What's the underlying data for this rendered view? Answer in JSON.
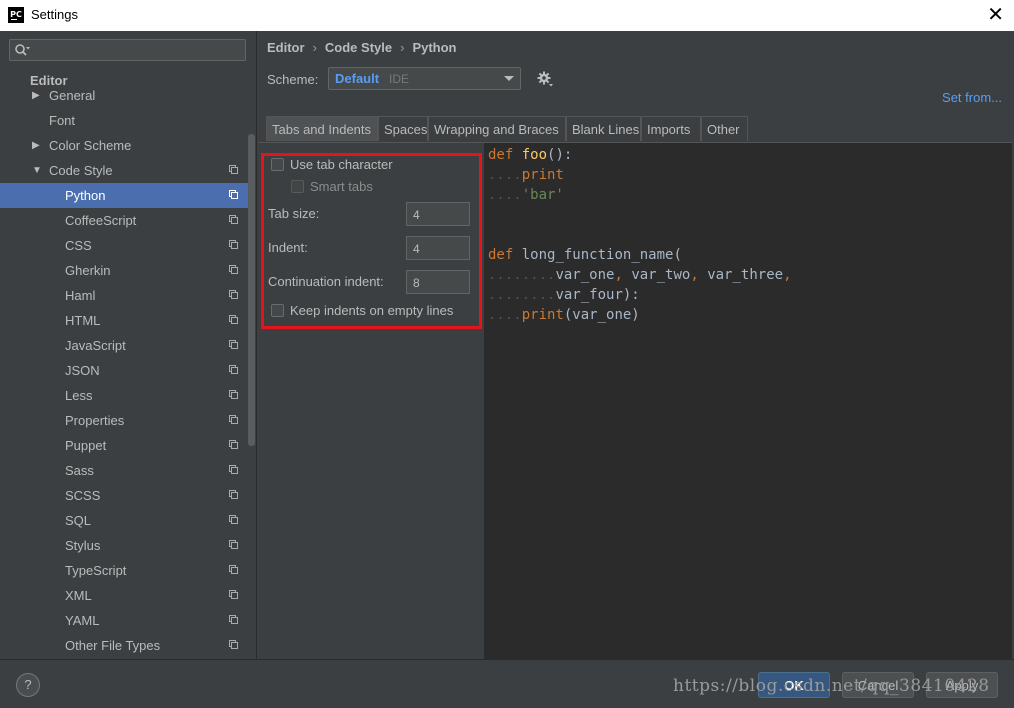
{
  "window": {
    "title": "Settings",
    "app_icon": "PC",
    "close_glyph": "✕"
  },
  "sidebar": {
    "search": {
      "value": "",
      "placeholder": ""
    },
    "section": "Editor",
    "items": [
      {
        "label": "General",
        "arrow": "▶",
        "level": 0
      },
      {
        "label": "Font",
        "arrow": "",
        "level": 0
      },
      {
        "label": "Color Scheme",
        "arrow": "▶",
        "level": 0
      },
      {
        "label": "Code Style",
        "arrow": "▼",
        "level": 0,
        "copy": true
      },
      {
        "label": "Python",
        "level": 1,
        "copy": true,
        "selected": true
      },
      {
        "label": "CoffeeScript",
        "level": 1,
        "copy": true
      },
      {
        "label": "CSS",
        "level": 1,
        "copy": true
      },
      {
        "label": "Gherkin",
        "level": 1,
        "copy": true
      },
      {
        "label": "Haml",
        "level": 1,
        "copy": true
      },
      {
        "label": "HTML",
        "level": 1,
        "copy": true
      },
      {
        "label": "JavaScript",
        "level": 1,
        "copy": true
      },
      {
        "label": "JSON",
        "level": 1,
        "copy": true
      },
      {
        "label": "Less",
        "level": 1,
        "copy": true
      },
      {
        "label": "Properties",
        "level": 1,
        "copy": true
      },
      {
        "label": "Puppet",
        "level": 1,
        "copy": true
      },
      {
        "label": "Sass",
        "level": 1,
        "copy": true
      },
      {
        "label": "SCSS",
        "level": 1,
        "copy": true
      },
      {
        "label": "SQL",
        "level": 1,
        "copy": true
      },
      {
        "label": "Stylus",
        "level": 1,
        "copy": true
      },
      {
        "label": "TypeScript",
        "level": 1,
        "copy": true
      },
      {
        "label": "XML",
        "level": 1,
        "copy": true
      },
      {
        "label": "YAML",
        "level": 1,
        "copy": true
      },
      {
        "label": "Other File Types",
        "level": 1,
        "copy": true
      }
    ]
  },
  "breadcrumb": {
    "items": [
      "Editor",
      "Code Style",
      "Python"
    ],
    "sep": "›"
  },
  "scheme": {
    "label": "Scheme:",
    "name": "Default",
    "sub": "IDE"
  },
  "set_from": "Set from...",
  "tabs": [
    "Tabs and Indents",
    "Spaces",
    "Wrapping and Braces",
    "Blank Lines",
    "Imports",
    "Other"
  ],
  "options": {
    "use_tab_character": "Use tab character",
    "smart_tabs": "Smart tabs",
    "tab_size_label": "Tab size:",
    "tab_size": "4",
    "indent_label": "Indent:",
    "indent": "4",
    "continuation_label": "Continuation indent:",
    "continuation": "8",
    "keep_indents": "Keep indents on empty lines"
  },
  "code": {
    "l1_kw": "def",
    "l1_fn": "foo",
    "l1_rest": "():",
    "l2_dots": "....",
    "l2_text": "print",
    "l3_dots": "....",
    "l3_str": "'bar'",
    "l6_kw": "def",
    "l6_fn": "long_function_name",
    "l6_rest": "(",
    "l7_dots": "........",
    "l7_a": "var_one",
    "l7_c1": ",",
    "l7_b": " var_two",
    "l7_c2": ",",
    "l7_c": " var_three",
    "l7_c3": ",",
    "l8_dots": "........",
    "l8_a": "var_four",
    "l8_rest": "):",
    "l9_dots": "....",
    "l9_fn": "print",
    "l9_rest": "(var_one)"
  },
  "footer": {
    "help": "?",
    "ok": "OK",
    "cancel": "Cancel",
    "apply": "Apply"
  },
  "watermark": "https://blog.csdn.net/qq_38410428",
  "colors": {
    "accent": "#4b6eaf",
    "link": "#589df6",
    "highlight": "#e5141b",
    "keyword": "#cc7832",
    "function": "#ffc66d",
    "string": "#6a8759"
  }
}
